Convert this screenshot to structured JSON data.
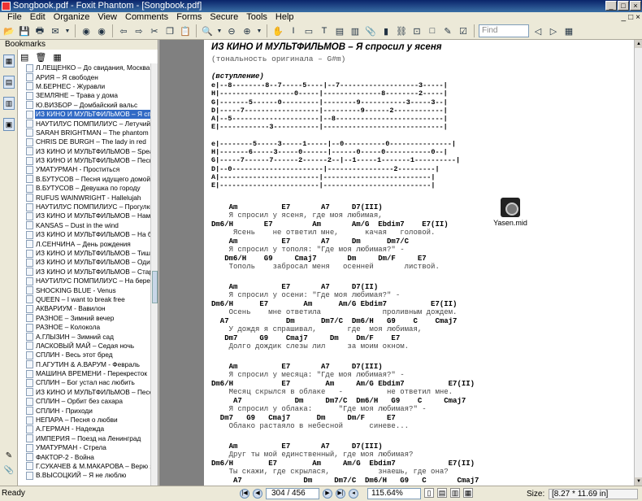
{
  "window": {
    "title": "Songbook.pdf - Foxit Phantom - [Songbook.pdf]",
    "controls": [
      "_",
      "□",
      "×"
    ]
  },
  "menu": [
    "File",
    "Edit",
    "Organize",
    "View",
    "Comments",
    "Forms",
    "Secure",
    "Tools",
    "Help"
  ],
  "toolbar": {
    "find_placeholder": "Find"
  },
  "sidebar": {
    "header": "Bookmarks",
    "bookmarks": [
      "Л.ЛЕЩЕНКО – До свидания, Москва",
      "АРИЯ – Я свободен",
      "М.БЕРНЕС - Журавли",
      "ЗЕМЛЯНЕ – Трава у дома",
      "Ю.ВИЗБОР – Домбайский вальс",
      "ИЗ КИНО И МУЛЬТФИЛЬМОВ – Я спросил",
      "НАУТИЛУС ПОМПИЛИУС – Летучий фре",
      "SARAH BRIGHTMAN – The phantom of th",
      "CHRIS DE BURGH – The lady in red",
      "ИЗ КИНО И МУЛЬТФИЛЬМОВ – Speak so",
      "ИЗ КИНО И МУЛЬТФИЛЬМОВ – Песня о",
      "УМАТУРМАН - Проститься",
      "В.БУТУСОВ – Песня идущего домой",
      "В.БУТУСОВ – Девушка по городу",
      "RUFUS WAINWRIGHT - Hallelujah",
      "НАУТИЛУС ПОМПИЛИУС – Прогулки по в",
      "ИЗ КИНО И МУЛЬТФИЛЬМОВ – Нам нуж",
      "KANSAS – Dust in the wind",
      "ИЗ КИНО И МУЛЬТФИЛЬМОВ – На безым",
      "Л.СЕНЧИНА – День рождения",
      "ИЗ КИНО И МУЛЬТФИЛЬМОВ – Тишина з",
      "ИЗ КИНО И МУЛЬТФИЛЬМОВ – Одинока",
      "ИЗ КИНО И МУЛЬТФИЛЬМОВ – Старый к",
      "НАУТИЛУС ПОМПИЛИУС – На берегу бе",
      "SHOCKING BLUE - Venus",
      "QUEEN – I want to break free",
      "АКВАРИУМ - Вавилон",
      "РАЗНОЕ – Зимний вечер",
      "РАЗНОЕ – Колокола",
      "А.ГЛЫЗИН – Зимний сад",
      "ЛАСКОВЫЙ МАЙ – Седая ночь",
      "СПЛИН - Весь этот бред",
      "П.АГУТИН & А.ВАРУМ - Февраль",
      "МАШИНА ВРЕМЕНИ - Перекресток",
      "СПЛИН – Бог устал нас любить",
      "ИЗ КИНО И МУЛЬТФИЛЬМОВ – Песенка",
      "СПЛИН – Орбит без сахара",
      "СПЛИН - Приходи",
      "НЕПАРА – Песня о любви",
      "А.ГЕРМАН - Надежда",
      "ИМПЕРИЯ – Поезд на Ленинград",
      "УМАТУРМАН - Стрела",
      "ФАКТОР-2 - Война",
      "Г.СУКАЧЕВ & М.МАКАРОВА – Верю я",
      "В.ВЫСОЦКИЙ – Я не люблю"
    ],
    "selected_index": 5
  },
  "document": {
    "title": "ИЗ КИНО И МУЛЬТФИЛЬМОВ – Я спросил у ясеня",
    "tonality": "(тональность оригинала – G#m)",
    "intro_label": "(вступление)",
    "tab1": [
      "e|--8--------8--7-----5----|--7-------------------3-----|",
      "H|------------------0-----|--------------8--------2-----|",
      "G|-------5------0---------|--------9-----------3-----3--|",
      "D|-----7------------------|---------9------2------------|",
      "A|--5---------------------|--8--------------------------|",
      "E|------------3-----------|-----------------------------|"
    ],
    "tab2": [
      "e|--------5-----3-----1-----|--0----------0---------------|",
      "H|-------6-----3-----0------|------0-----0-----------0--|",
      "G|-----7------7------2------2--|--1-----1-------1----------|",
      "D|--0----------------------|----------------2---------|",
      "A|------------------------|--------------------------|",
      "E|------------------------|--------------------------|"
    ],
    "verses": [
      [
        {
          "t": "c",
          "s": "    Am          E7       A7     D7(III)"
        },
        {
          "t": "l",
          "s": "    Я спросил у ясеня, где моя любимая,"
        },
        {
          "t": "c",
          "s": "Dm6/H       E7         Am       Am/G  Ebdim7    E7(II)"
        },
        {
          "t": "l",
          "s": "     Ясень    не ответил мне,      качая   головой."
        },
        {
          "t": "c",
          "s": "    Am          E7       A7     Dm      Dm7/C"
        },
        {
          "t": "l",
          "s": "    Я спросил у тополя: \"Где моя любимая?\" -"
        },
        {
          "t": "c",
          "s": "   Dm6/H    G9     Cmaj7       Dm     Dm/F     E7"
        },
        {
          "t": "l",
          "s": "    Тополь    забросал меня   осенней       листвой."
        }
      ],
      [
        {
          "t": "c",
          "s": "    Am          E7       A7     D7(II)"
        },
        {
          "t": "l",
          "s": "    Я спросил у осени: \"Где моя любимая?\" -"
        },
        {
          "t": "c",
          "s": "Dm6/H      E7        Am      Am/G Ebdim7          E7(II)"
        },
        {
          "t": "l",
          "s": "    Осень    мне ответила              проливным дождем."
        },
        {
          "t": "c",
          "s": "  A7             Dm      Dm7/C  Dm6/H   G9    C    Cmaj7"
        },
        {
          "t": "l",
          "s": "    У дождя я спрашивал,       где  моя любимая,"
        },
        {
          "t": "c",
          "s": "   Dm7     G9    Cmaj7     Dm    Dm/F    E7"
        },
        {
          "t": "l",
          "s": "    Долго дождик слезы лил     за моим окном."
        }
      ],
      [
        {
          "t": "c",
          "s": "    Am          E7       A7     D7(III)"
        },
        {
          "t": "l",
          "s": "    Я спросил у месяца: \"Где моя любимая?\" -"
        },
        {
          "t": "c",
          "s": "Dm6/H           E7        Am     Am/G Ebdim7          E7(II)"
        },
        {
          "t": "l",
          "s": "    Месяц скрылся в облаке   -          не ответил мне."
        },
        {
          "t": "c",
          "s": "     A7            Dm     Dm7/C  Dm6/H   G9    C     Cmaj7"
        },
        {
          "t": "l",
          "s": "    Я спросил у облака:      \"Где моя любимая?\" -"
        },
        {
          "t": "c",
          "s": "  Dm7   G9   Cmaj7      Dm     Dm/F     E7"
        },
        {
          "t": "l",
          "s": "    Облако растаяло в небесной      синеве..."
        }
      ],
      [
        {
          "t": "c",
          "s": "    Am          E7       A7     D7(III)"
        },
        {
          "t": "l",
          "s": "    Друг ты мой единственный, где моя любимая?"
        },
        {
          "t": "c",
          "s": "Dm6/H        E7        Am     Am/G  Ebdim7            E7(II)"
        },
        {
          "t": "l",
          "s": "    Ты скажи, где скрылася,           знаешь, где она?"
        },
        {
          "t": "c",
          "s": "     A7              Dm     Dm7/C  Dm6/H   G9   C       Cmaj7"
        }
      ]
    ],
    "attachment": "Yasen.mid"
  },
  "status": {
    "ready": "Ready",
    "page": "304 / 456",
    "zoom": "115.64%",
    "size_label": "Size:",
    "size": "[8.27 * 11.69 in]"
  }
}
